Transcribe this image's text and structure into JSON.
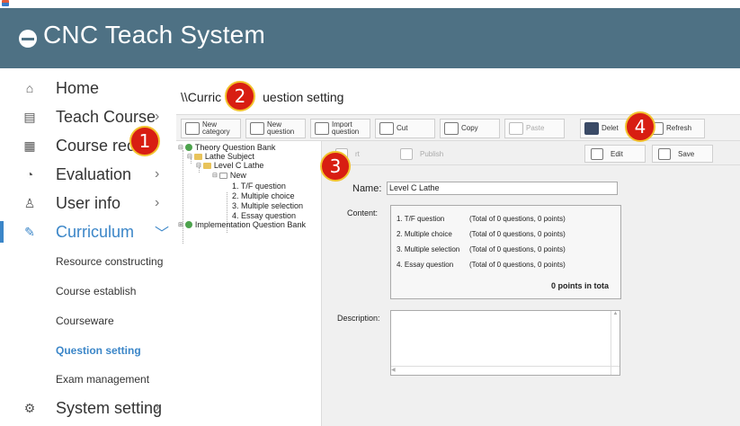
{
  "header": {
    "title": "CNC Teach System"
  },
  "sidebar": {
    "items": [
      {
        "label": "Home",
        "icon": "home-icon",
        "glyph": "⌂",
        "chevron": ""
      },
      {
        "label": "Teach Course",
        "icon": "list-icon",
        "glyph": "▤",
        "chevron": "›"
      },
      {
        "label": "Course reco",
        "icon": "document-icon",
        "glyph": "▦",
        "chevron": ""
      },
      {
        "label": "Evaluation",
        "icon": "chart-icon",
        "glyph": "◔",
        "chevron": "›"
      },
      {
        "label": "User info",
        "icon": "user-icon",
        "glyph": "♙",
        "chevron": "›"
      },
      {
        "label": "Curriculum",
        "icon": "edit-icon",
        "glyph": "✎",
        "chevron": "﹀"
      },
      {
        "label": "System setting",
        "icon": "gear-icon",
        "glyph": "⚙",
        "chevron": "›"
      }
    ],
    "subitems": [
      {
        "label": "Resource constructing"
      },
      {
        "label": "Course establish"
      },
      {
        "label": "Courseware"
      },
      {
        "label": "Question setting"
      },
      {
        "label": "Exam management"
      }
    ]
  },
  "breadcrumb": {
    "prefix": "\\\\Curric",
    "suffix": "uestion setting"
  },
  "toolbar": {
    "new_category": {
      "line1": "New",
      "line2": "category"
    },
    "new_question": {
      "line1": "New",
      "line2": "question"
    },
    "import_question": {
      "line1": "Import",
      "line2": "question"
    },
    "cut": "Cut",
    "copy": "Copy",
    "paste": "Paste",
    "delete": "Delet",
    "refresh": "Refresh"
  },
  "tree": {
    "theory_bank": "Theory Question Bank",
    "lathe_subject": "Lathe Subject",
    "level_c": "Level C Lathe",
    "new_node": "New",
    "leaves": [
      "1. T/F question",
      "2. Multiple choice",
      "3. Multiple selection",
      "4. Essay question"
    ],
    "implementation_bank": "Implementation Question Bank"
  },
  "detail_toolbar": {
    "export_frag": "rt",
    "publish": "Publish",
    "edit": "Edit",
    "save": "Save"
  },
  "form": {
    "name_label": "Name:",
    "name_value": "Level C Lathe",
    "content_label": "Content:",
    "content_rows": [
      {
        "q": "1. T/F question",
        "total": "(Total of 0 questions, 0 points)"
      },
      {
        "q": "2. Multiple choice",
        "total": "(Total of 0 questions, 0 points)"
      },
      {
        "q": "3. Multiple selection",
        "total": "(Total of 0 questions, 0 points)"
      },
      {
        "q": "4. Essay question",
        "total": "(Total of 0 questions, 0 points)"
      }
    ],
    "total_text": "0 points in tota",
    "description_label": "Description:"
  },
  "callouts": [
    "1",
    "2",
    "3",
    "4"
  ],
  "colors": {
    "header_bg": "#4e7184",
    "accent": "#3b86c8",
    "callout": "#d81e12",
    "callout_border": "#f2c22d"
  }
}
